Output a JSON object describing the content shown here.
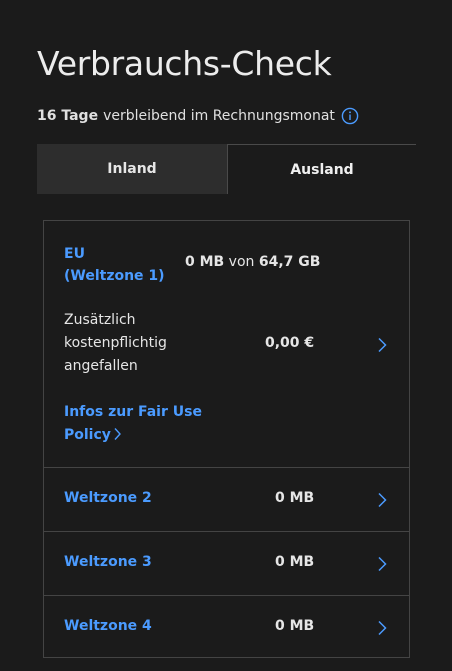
{
  "header": {
    "title": "Verbrauchs-Check",
    "days_remaining": "16 Tage",
    "days_suffix": "verbleibend im Rechnungsmonat"
  },
  "tabs": [
    {
      "label": "Inland",
      "active": false
    },
    {
      "label": "Ausland",
      "active": true
    }
  ],
  "eu": {
    "label_line1": "EU",
    "label_line2": "(Weltzone 1)",
    "used": "0 MB",
    "of_word": "von",
    "total": "64,7 GB",
    "extra_line1": "Zusätzlich",
    "extra_line2": "kostenpflichtig",
    "extra_line3": "angefallen",
    "extra_value": "0,00 €",
    "fairuse_line1": "Infos zur Fair Use",
    "fairuse_line2": "Policy"
  },
  "zones": [
    {
      "label": "Weltzone 2",
      "value": "0 MB"
    },
    {
      "label": "Weltzone 3",
      "value": "0 MB"
    },
    {
      "label": "Weltzone 4",
      "value": "0 MB"
    }
  ],
  "colors": {
    "accent": "#4b9bff",
    "background": "#1b1b1b",
    "tab_inactive_bg": "#2d2d2d",
    "border": "#444444"
  },
  "icons": {
    "info": "info-icon",
    "chevron": "chevron-right-icon"
  }
}
